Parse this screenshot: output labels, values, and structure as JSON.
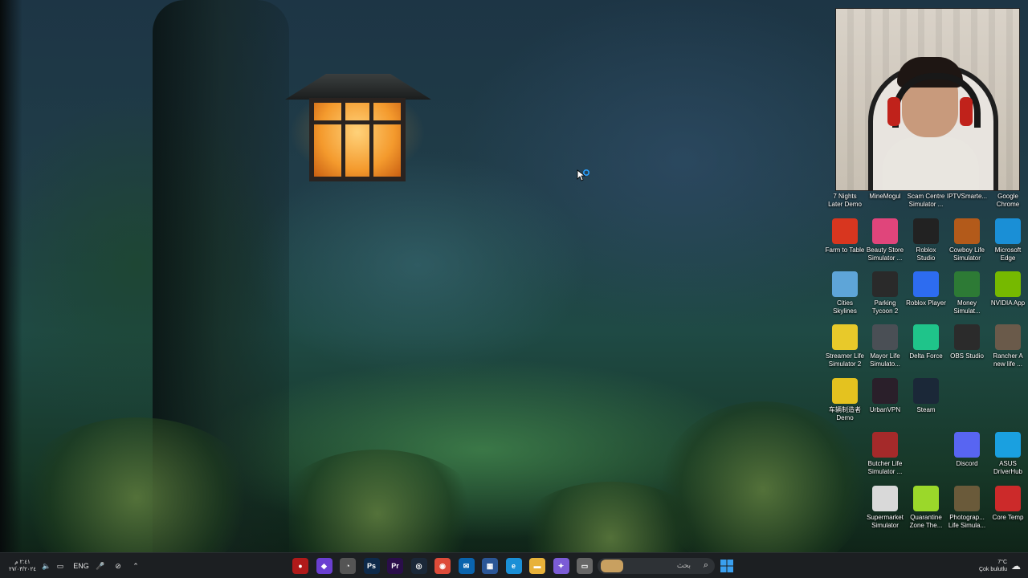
{
  "desktop": {
    "icons": [
      {
        "label": "7 Nights\nLater Demo",
        "icon": "game-icon",
        "color": "#3a3a3a"
      },
      {
        "label": "MineMogul",
        "icon": "game-icon",
        "color": "#4a3a2a"
      },
      {
        "label": "Scam Centre\nSimulator ...",
        "icon": "game-icon",
        "color": "#2a3a4a"
      },
      {
        "label": "IPTVSmarte...",
        "icon": "tv-icon",
        "color": "#1e6ea7"
      },
      {
        "label": "Google\nChrome",
        "icon": "chrome-icon",
        "color": "#ffffff"
      },
      {
        "label": "Farm to Table",
        "icon": "tomato-icon",
        "color": "#d8361f"
      },
      {
        "label": "Beauty Store\nSimulator ...",
        "icon": "beauty-store-icon",
        "color": "#e0457b"
      },
      {
        "label": "Roblox\nStudio",
        "icon": "roblox-studio-icon",
        "color": "#222222"
      },
      {
        "label": "Cowboy Life\nSimulator",
        "icon": "cowboy-icon",
        "color": "#b35a1a"
      },
      {
        "label": "Microsoft\nEdge",
        "icon": "edge-icon",
        "color": "#1a8fd6"
      },
      {
        "label": "Cities\nSkylines",
        "icon": "cities-icon",
        "color": "#5ea5d8"
      },
      {
        "label": "Parking\nTycoon 2",
        "icon": "parking-icon",
        "color": "#2a2a2a"
      },
      {
        "label": "Roblox Player",
        "icon": "roblox-icon",
        "color": "#2d6cf0"
      },
      {
        "label": "Money\nSimulat...",
        "icon": "money-icon",
        "color": "#2d7a35"
      },
      {
        "label": "NVIDIA App",
        "icon": "nvidia-icon",
        "color": "#76b900"
      },
      {
        "label": "Streamer Life\nSimulator 2",
        "icon": "streamer-icon",
        "color": "#e8c92a"
      },
      {
        "label": "Mayor Life\nSimulato...",
        "icon": "mayor-icon",
        "color": "#4a4f55"
      },
      {
        "label": "Delta Force",
        "icon": "delta-force-icon",
        "color": "#1fc48a"
      },
      {
        "label": "OBS Studio",
        "icon": "obs-icon",
        "color": "#2b2b2b"
      },
      {
        "label": "Rancher A\nnew life ...",
        "icon": "rancher-icon",
        "color": "#6a5a4a"
      },
      {
        "label": "车辆制造者\nDemo",
        "icon": "car-maker-icon",
        "color": "#e4c21f"
      },
      {
        "label": "UrbanVPN",
        "icon": "vpn-icon",
        "color": "#2a1f2a"
      },
      {
        "label": "Steam",
        "icon": "steam-icon",
        "color": "#1b2838"
      },
      {
        "label": "Butcher Life\nSimulator ...",
        "icon": "butcher-icon",
        "color": "#a52a2a"
      },
      {
        "label": "Discord",
        "icon": "discord-icon",
        "color": "#5865f2"
      },
      {
        "label": "ASUS\nDriverHub",
        "icon": "asus-icon",
        "color": "#1aa0e0"
      },
      {
        "label": "Supermarket\nSimulator",
        "icon": "supermarket-icon",
        "color": "#d9d9d9"
      },
      {
        "label": "Quarantine\nZone The...",
        "icon": "quarantine-icon",
        "color": "#9bd82a"
      },
      {
        "label": "Photograp...\nLife Simula...",
        "icon": "photo-icon",
        "color": "#6a5a3a"
      },
      {
        "label": "Core Temp",
        "icon": "thermometer-icon",
        "color": "#cc2a2a"
      }
    ]
  },
  "taskbar": {
    "clock_time": "٢:٤١ م",
    "clock_date": "٢٧/٠٣/٢٠٢٤",
    "language": "ENG",
    "search_placeholder": "بحث",
    "weather_temp": "7°C",
    "weather_desc": "Çok bulutlu",
    "pinned_apps": [
      {
        "name": "app-red",
        "glyph": "●",
        "color": "#b01a1a"
      },
      {
        "name": "app-purple",
        "glyph": "◆",
        "color": "#6a3fd1"
      },
      {
        "name": "app-clock",
        "glyph": "◔",
        "color": "#555"
      },
      {
        "name": "photoshop",
        "glyph": "Ps",
        "color": "#0e2a4a"
      },
      {
        "name": "premiere",
        "glyph": "Pr",
        "color": "#2a0e4a"
      },
      {
        "name": "steam",
        "glyph": "◎",
        "color": "#1b2838"
      },
      {
        "name": "chrome",
        "glyph": "◉",
        "color": "#dd4b39"
      },
      {
        "name": "outlook",
        "glyph": "✉",
        "color": "#0a64ad"
      },
      {
        "name": "store",
        "glyph": "▦",
        "color": "#2b5797"
      },
      {
        "name": "edge",
        "glyph": "e",
        "color": "#1a8fd6"
      },
      {
        "name": "file-explorer",
        "glyph": "▬",
        "color": "#e8b23a"
      },
      {
        "name": "copilot",
        "glyph": "✦",
        "color": "#7b5cd6"
      },
      {
        "name": "window",
        "glyph": "▭",
        "color": "#666"
      }
    ]
  }
}
